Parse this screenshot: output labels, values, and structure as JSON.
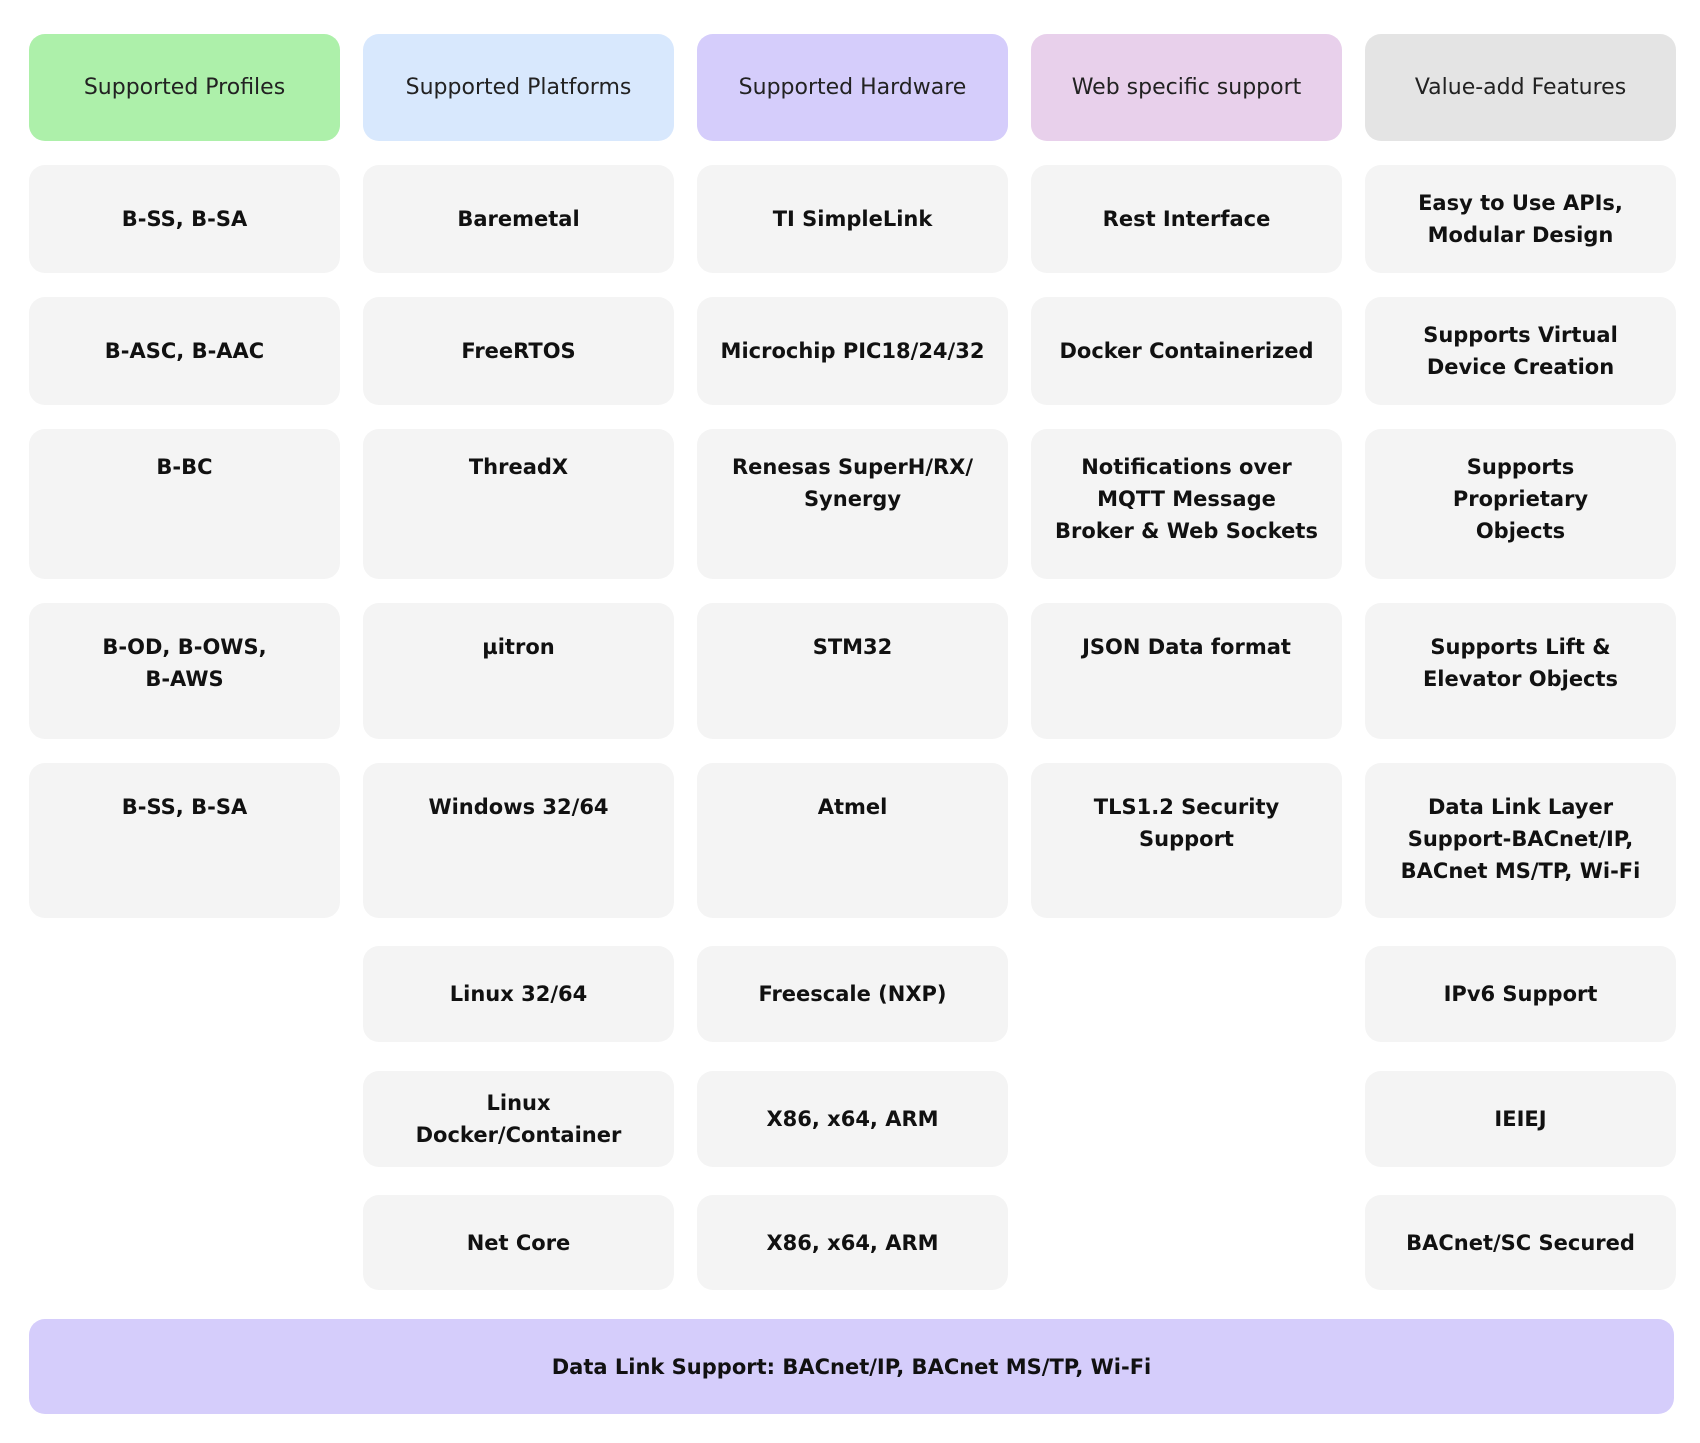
{
  "columns": [
    {
      "header": "Supported Profiles",
      "header_color": "#adf0aa",
      "items": [
        "B-SS, B-SA",
        "B-ASC, B-AAC",
        "B-BC",
        "B-OD, B-OWS,\nB-AWS",
        "B-SS, B-SA"
      ]
    },
    {
      "header": "Supported Platforms",
      "header_color": "#d8e8fd",
      "items": [
        "Baremetal",
        "FreeRTOS",
        "ThreadX",
        "µitron",
        "Windows 32/64",
        "Linux 32/64",
        "Linux Docker/Container",
        "Net Core"
      ]
    },
    {
      "header": "Supported Hardware",
      "header_color": "#d5cdfb",
      "items": [
        "TI SimpleLink",
        "Microchip PIC18/24/32",
        "Renesas SuperH/RX/\nSynergy",
        "STM32",
        "Atmel",
        "Freescale (NXP)",
        "X86, x64, ARM",
        "X86, x64, ARM"
      ]
    },
    {
      "header": "Web specific support",
      "header_color": "#e8d0eb",
      "items": [
        "Rest Interface",
        "Docker Containerized",
        "Notifications over\nMQTT Message\nBroker & Web Sockets",
        "JSON Data format",
        "TLS1.2 Security\nSupport"
      ]
    },
    {
      "header": "Value-add Features",
      "header_color": "#e4e4e4",
      "items": [
        "Easy to Use APIs,\nModular Design",
        "Supports Virtual\nDevice Creation",
        "Supports\nProprietary\nObjects",
        "Supports Lift &\nElevator Objects",
        "Data Link Layer\nSupport-BACnet/IP,\nBACnet MS/TP, Wi-Fi",
        "IPv6 Support",
        "IEIEJ",
        "BACnet/SC Secured"
      ]
    }
  ],
  "footer": {
    "label": "Data Link Support: BACnet/IP, BACnet MS/TP, Wi-Fi",
    "color": "#d5cdfb"
  }
}
